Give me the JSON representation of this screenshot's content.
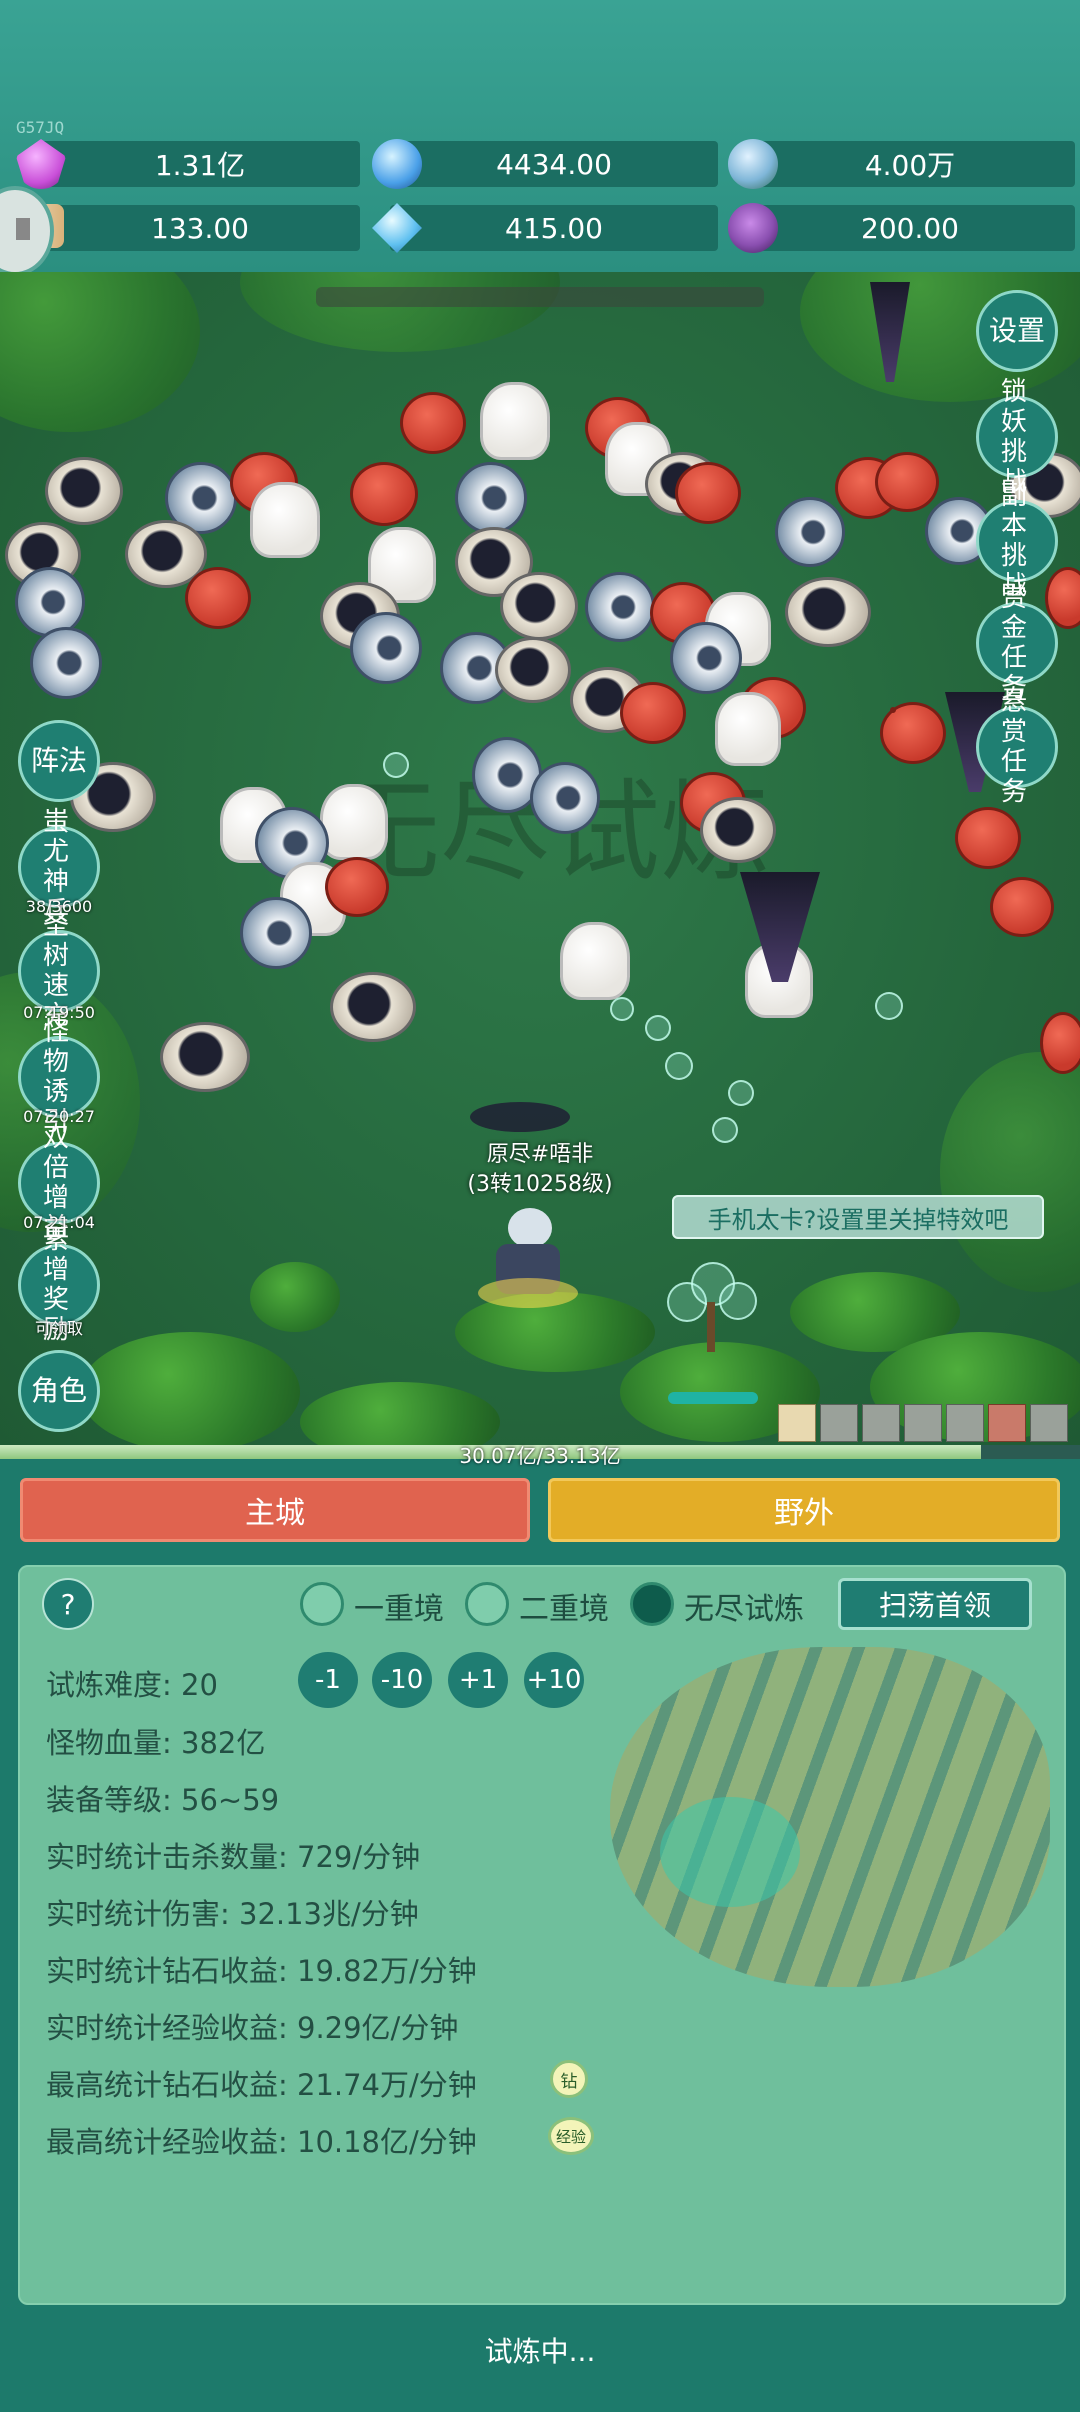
{
  "tag": "G57JQ",
  "resources": [
    {
      "icon": "purple-gem-icon",
      "value": "1.31亿",
      "color": "#c94fd8"
    },
    {
      "icon": "blue-orb-icon",
      "value": "4434.00",
      "color": "#4aa0e8"
    },
    {
      "icon": "globe-icon",
      "value": "4.00万",
      "color": "#7fb6d8"
    },
    {
      "icon": "scroll-icon",
      "value": "133.00",
      "color": "#d9b27a"
    },
    {
      "icon": "blue-crystal-icon",
      "value": "415.00",
      "color": "#5fc0f0"
    },
    {
      "icon": "purple-pouch-icon",
      "value": "200.00",
      "color": "#8a4fb0"
    }
  ],
  "scene": {
    "watermark": "无尽试炼",
    "player_name": "原尽#唔非",
    "player_level": "(3转10258级)",
    "tip": "手机太卡?设置里关掉特效吧",
    "xp_text": "30.07亿/33.13亿",
    "xp_fraction": 0.908
  },
  "left_buttons": [
    {
      "label": "阵法",
      "timer": ""
    },
    {
      "label": "蚩尤神兵",
      "timer": "38/3600"
    },
    {
      "label": "圣树速充",
      "timer": "07:19:50"
    },
    {
      "label": "怪物诱引",
      "timer": "07:20:27"
    },
    {
      "label": "双倍增益",
      "timer": "07:21:04"
    },
    {
      "label": "累增奖励",
      "timer": "可领取"
    },
    {
      "label": "角色",
      "timer": ""
    }
  ],
  "right_buttons": [
    {
      "label": "设置"
    },
    {
      "label": "锁妖挑战"
    },
    {
      "label": "副本挑战"
    },
    {
      "label": "赏金任务"
    },
    {
      "label": "悬赏任务"
    }
  ],
  "tabs": {
    "main_city": "主城",
    "wild": "野外"
  },
  "panel": {
    "help": "?",
    "modes": [
      "一重境",
      "二重境",
      "无尽试炼"
    ],
    "selected_mode": "无尽试炼",
    "sweep": "扫荡首领",
    "adjust": [
      "-1",
      "-10",
      "+1",
      "+10"
    ],
    "stats": [
      "试炼难度: 20",
      "怪物血量: 382亿",
      "装备等级: 56~59",
      "实时统计击杀数量: 729/分钟",
      "实时统计伤害: 32.13兆/分钟",
      "实时统计钻石收益: 19.82万/分钟",
      "实时统计经验收益: 9.29亿/分钟",
      "最高统计钻石收益: 21.74万/分钟",
      "最高统计经验收益: 10.18亿/分钟"
    ],
    "badges": [
      "钻",
      "经验"
    ]
  },
  "status": "试炼中..."
}
